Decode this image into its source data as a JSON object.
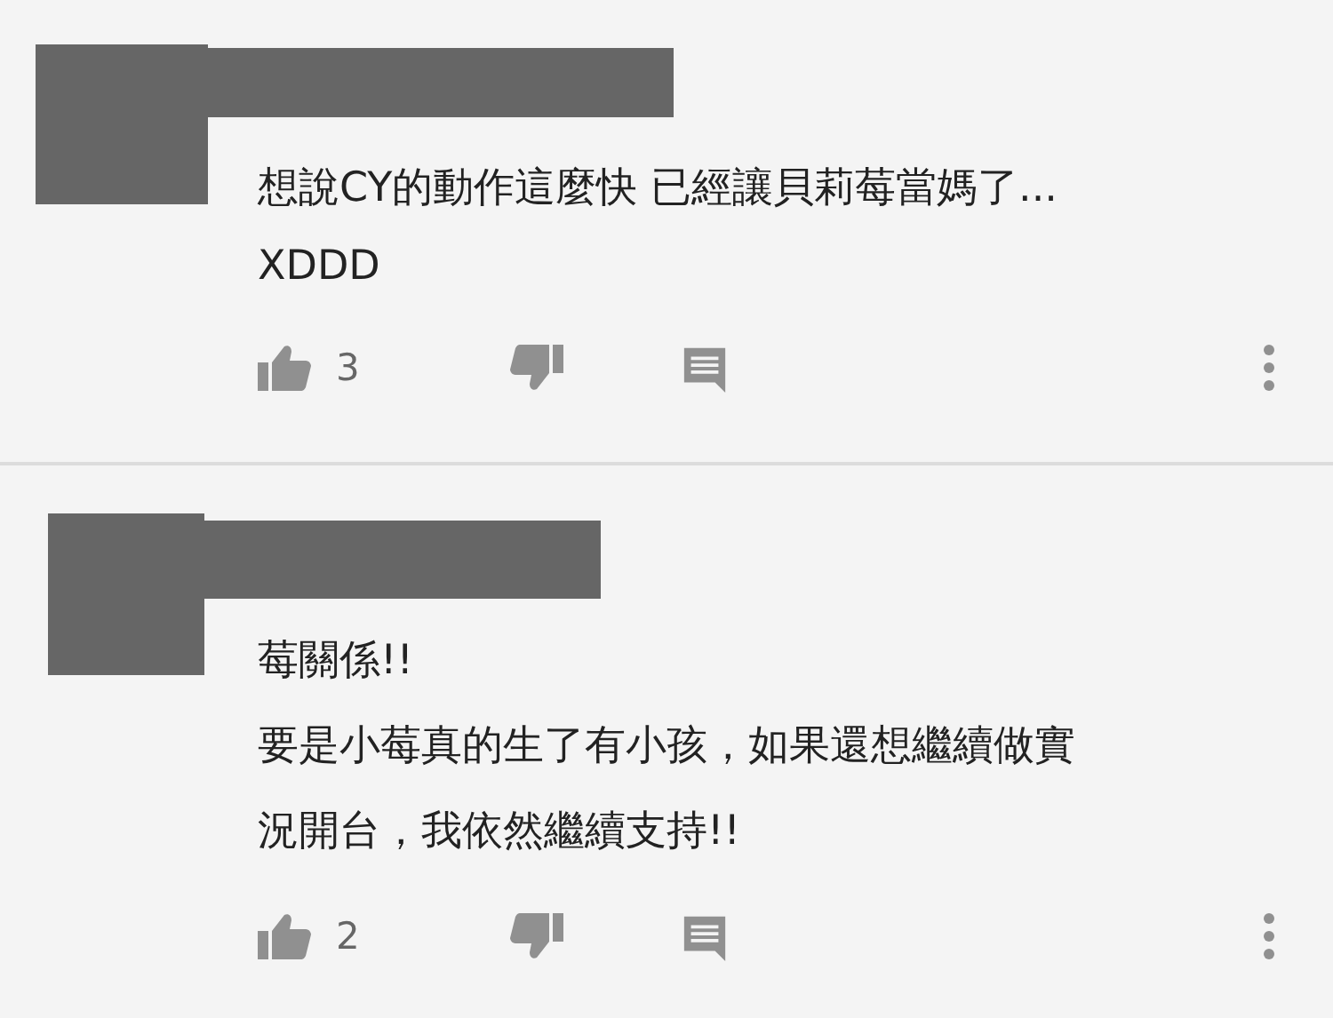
{
  "comments": [
    {
      "lines": [
        "想說CY的動作這麼快 已經讓貝莉莓當媽了...",
        "XDDD"
      ],
      "likes": "3"
    },
    {
      "lines": [
        "莓關係!!",
        "要是小莓真的生了有小孩，如果還想繼續做實",
        "況開台，我依然繼續支持!!"
      ],
      "likes": "2"
    }
  ]
}
